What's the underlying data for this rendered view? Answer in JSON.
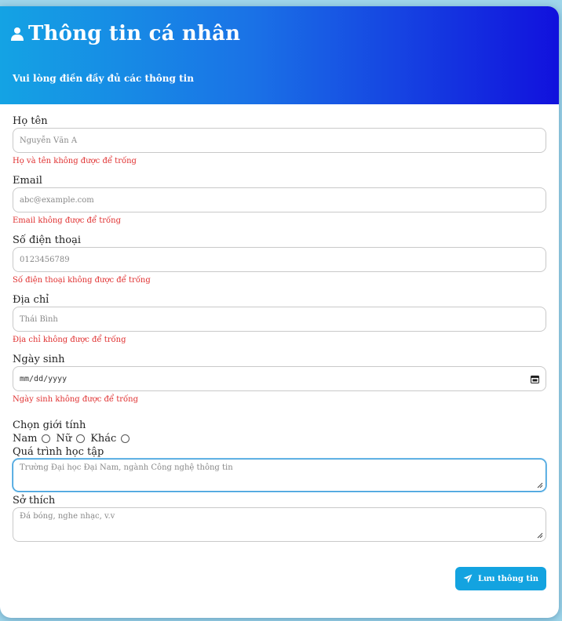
{
  "header": {
    "title": "Thông tin cá nhân",
    "subtitle": "Vui lòng điền đầy đủ các thông tin",
    "icon": "user-icon"
  },
  "fields": {
    "name": {
      "label": "Họ tên",
      "placeholder": "Nguyễn Văn A",
      "error": "Họ và tên không được để trống"
    },
    "email": {
      "label": "Email",
      "placeholder": "abc@example.com",
      "error": "Email không được để trống"
    },
    "phone": {
      "label": "Số điện thoại",
      "placeholder": "0123456789",
      "error": "Số điện thoại không được để trống"
    },
    "address": {
      "label": "Địa chỉ",
      "placeholder": "Thái Bình",
      "error": "Địa chỉ không được để trống"
    },
    "dob": {
      "label": "Ngày sinh",
      "placeholder": "mm/dd/yyyy",
      "error": "Ngày sinh không được để trống"
    },
    "gender": {
      "label": "Chọn giới tính",
      "options": [
        "Nam",
        "Nữ",
        "Khác"
      ]
    },
    "education": {
      "label": "Quá trình học tập",
      "placeholder": "Trường Đại học Đại Nam, ngành Công nghệ thông tin"
    },
    "hobbies": {
      "label": "Sở thích",
      "placeholder": "Đá bóng, nghe nhạc, v.v"
    }
  },
  "actions": {
    "save_label": "Lưu thông tin",
    "save_icon": "send-icon"
  },
  "colors": {
    "header_gradient_start": "#14a3e4",
    "header_gradient_end": "#1111dd",
    "error": "#e03030",
    "button": "#13a3e0"
  }
}
